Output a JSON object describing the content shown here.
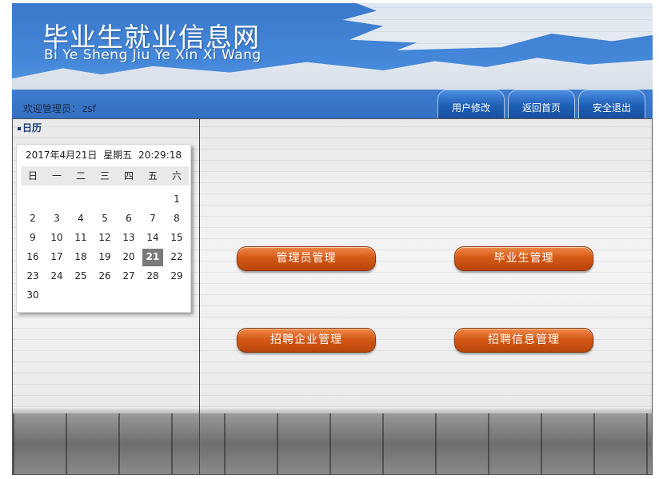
{
  "header": {
    "title": "毕业生就业信息网",
    "subtitle": "Bi Ye Sheng Jiu Ye Xin Xi Wang",
    "welcome_label": "欢迎管理员：",
    "username": "zsf",
    "buttons": {
      "edit_user": "用户修改",
      "home": "返回首页",
      "logout": "安全退出"
    }
  },
  "sidebar": {
    "title": "日历",
    "calendar": {
      "date_text": "2017年4月21日",
      "weekday_text": "星期五",
      "time_text": "20:29:18",
      "weekdays": [
        "日",
        "一",
        "二",
        "三",
        "四",
        "五",
        "六"
      ],
      "leading_blanks": 6,
      "days": [
        "1",
        "2",
        "3",
        "4",
        "5",
        "6",
        "7",
        "8",
        "9",
        "10",
        "11",
        "12",
        "13",
        "14",
        "15",
        "16",
        "17",
        "18",
        "19",
        "20",
        "21",
        "22",
        "23",
        "24",
        "25",
        "26",
        "27",
        "28",
        "29",
        "30"
      ],
      "today": "21"
    }
  },
  "main": {
    "buttons": {
      "admin": "管理员管理",
      "graduate": "毕业生管理",
      "company": "招聘企业管理",
      "job": "招聘信息管理"
    }
  },
  "colors": {
    "header_blue": "#3f7ed0",
    "tab_blue": "#1e5fb6",
    "button_orange": "#d55a16",
    "today_highlight": "#7a7a7a"
  }
}
